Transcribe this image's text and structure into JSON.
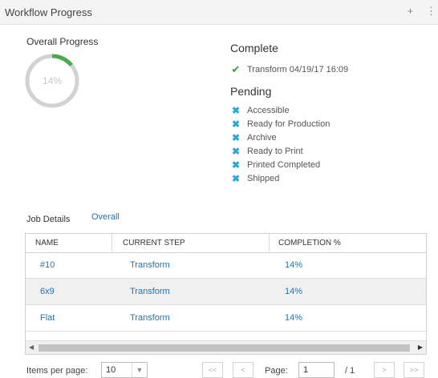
{
  "header": {
    "title": "Workflow Progress",
    "icon_add": "+",
    "icon_more": "⋮"
  },
  "overall": {
    "label": "Overall Progress",
    "percent_text": "14%",
    "percent_value": 0.14,
    "ring_color": "#4aa94a",
    "track_color": "#d2d2d2"
  },
  "complete": {
    "title": "Complete",
    "items": [
      {
        "label": "Transform 04/19/17 16:09",
        "icon": "check-icon"
      }
    ]
  },
  "pending": {
    "title": "Pending",
    "items": [
      {
        "label": "Accessible",
        "icon": "cross-icon"
      },
      {
        "label": "Ready for Production",
        "icon": "cross-icon"
      },
      {
        "label": "Archive",
        "icon": "cross-icon"
      },
      {
        "label": "Ready to Print",
        "icon": "cross-icon"
      },
      {
        "label": "Printed Completed",
        "icon": "cross-icon"
      },
      {
        "label": "Shipped",
        "icon": "cross-icon"
      }
    ]
  },
  "job_details": {
    "label": "Job Details",
    "tab_overall": "Overall",
    "columns": [
      "NAME",
      "CURRENT STEP",
      "COMPLETION %"
    ],
    "rows": [
      {
        "name": "#10",
        "step": "Transform",
        "completion": "14%"
      },
      {
        "name": "6x9",
        "step": "Transform",
        "completion": "14%"
      },
      {
        "name": "Flat",
        "step": "Transform",
        "completion": "14%"
      }
    ]
  },
  "pagination": {
    "items_per_page_label": "Items per page:",
    "items_per_page_value": "10",
    "first": "<<",
    "prev": "<",
    "page_label": "Page:",
    "page_value": "1",
    "total": "/ 1",
    "next": ">",
    "last": ">>"
  },
  "colors": {
    "link": "#1f73b7",
    "check": "#3a9a3a",
    "cross": "#2aa6d8"
  }
}
